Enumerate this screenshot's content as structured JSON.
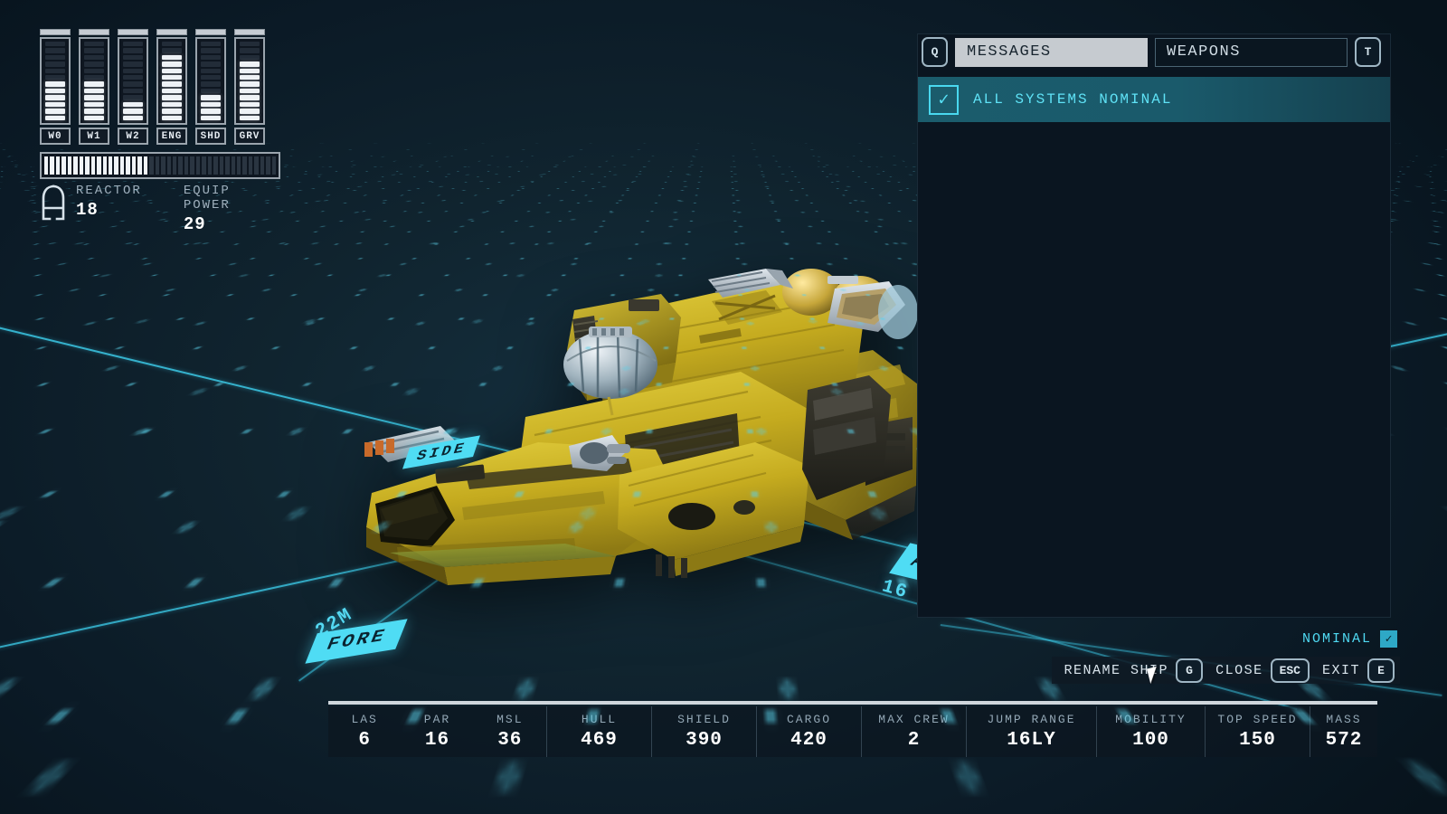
{
  "power_hud": {
    "bars": [
      {
        "label": "W0",
        "segments": 12,
        "filled": 6
      },
      {
        "label": "W1",
        "segments": 12,
        "filled": 6
      },
      {
        "label": "W2",
        "segments": 12,
        "filled": 3
      },
      {
        "label": "ENG",
        "segments": 12,
        "filled": 10
      },
      {
        "label": "SHD",
        "segments": 12,
        "filled": 4
      },
      {
        "label": "GRV",
        "segments": 12,
        "filled": 9
      }
    ],
    "reactor_bar": {
      "segments": 40,
      "filled": 18
    },
    "reactor_label": "REACTOR",
    "reactor_value": "18",
    "equip_power_label": "EQUIP POWER",
    "equip_power_value": "29",
    "reactor_icon": "reactor-grade-a-icon"
  },
  "messages_panel": {
    "prev_key": "Q",
    "next_key": "T",
    "tabs": [
      {
        "label": "MESSAGES",
        "active": true
      },
      {
        "label": "WEAPONS",
        "active": false
      }
    ],
    "entries": [
      {
        "icon": "check-icon",
        "text": "ALL SYSTEMS NOMINAL"
      }
    ]
  },
  "status_badge": {
    "label": "NOMINAL",
    "icon": "check-icon"
  },
  "actions": [
    {
      "label": "RENAME SHIP",
      "key": "G",
      "name": "rename-ship"
    },
    {
      "label": "CLOSE",
      "key": "ESC",
      "name": "close"
    },
    {
      "label": "EXIT",
      "key": "E",
      "name": "exit"
    }
  ],
  "viewport": {
    "dimension_length": "22M",
    "dimension_width": "16",
    "tag_fore": "FORE",
    "tag_aft": "AFT",
    "tag_side": "SIDE"
  },
  "stats": {
    "groups": [
      {
        "name": "weapons",
        "items": [
          {
            "key": "LAS",
            "value": "6"
          },
          {
            "key": "PAR",
            "value": "16"
          },
          {
            "key": "MSL",
            "value": "36"
          }
        ]
      },
      {
        "name": "hull",
        "items": [
          {
            "key": "HULL",
            "value": "469"
          }
        ]
      },
      {
        "name": "shield",
        "items": [
          {
            "key": "SHIELD",
            "value": "390"
          }
        ]
      },
      {
        "name": "cargo",
        "items": [
          {
            "key": "CARGO",
            "value": "420"
          }
        ]
      },
      {
        "name": "crew",
        "items": [
          {
            "key": "MAX CREW",
            "value": "2"
          }
        ]
      },
      {
        "name": "jump",
        "items": [
          {
            "key": "JUMP RANGE",
            "value": "16LY"
          }
        ]
      },
      {
        "name": "mobility",
        "items": [
          {
            "key": "MOBILITY",
            "value": "100"
          }
        ]
      },
      {
        "name": "speed",
        "items": [
          {
            "key": "TOP SPEED",
            "value": "150"
          }
        ]
      },
      {
        "name": "mass",
        "items": [
          {
            "key": "MASS",
            "value": "572"
          }
        ]
      }
    ],
    "group_widths": [
      242,
      116,
      116,
      116,
      116,
      144,
      120,
      116,
      74
    ]
  },
  "colors": {
    "accent_cyan": "#4fdcf4",
    "panel_bg": "#0a1520",
    "message_row": "#1b5c6c",
    "hull_yellow": "#c9b022",
    "background": "#0b1a26"
  }
}
